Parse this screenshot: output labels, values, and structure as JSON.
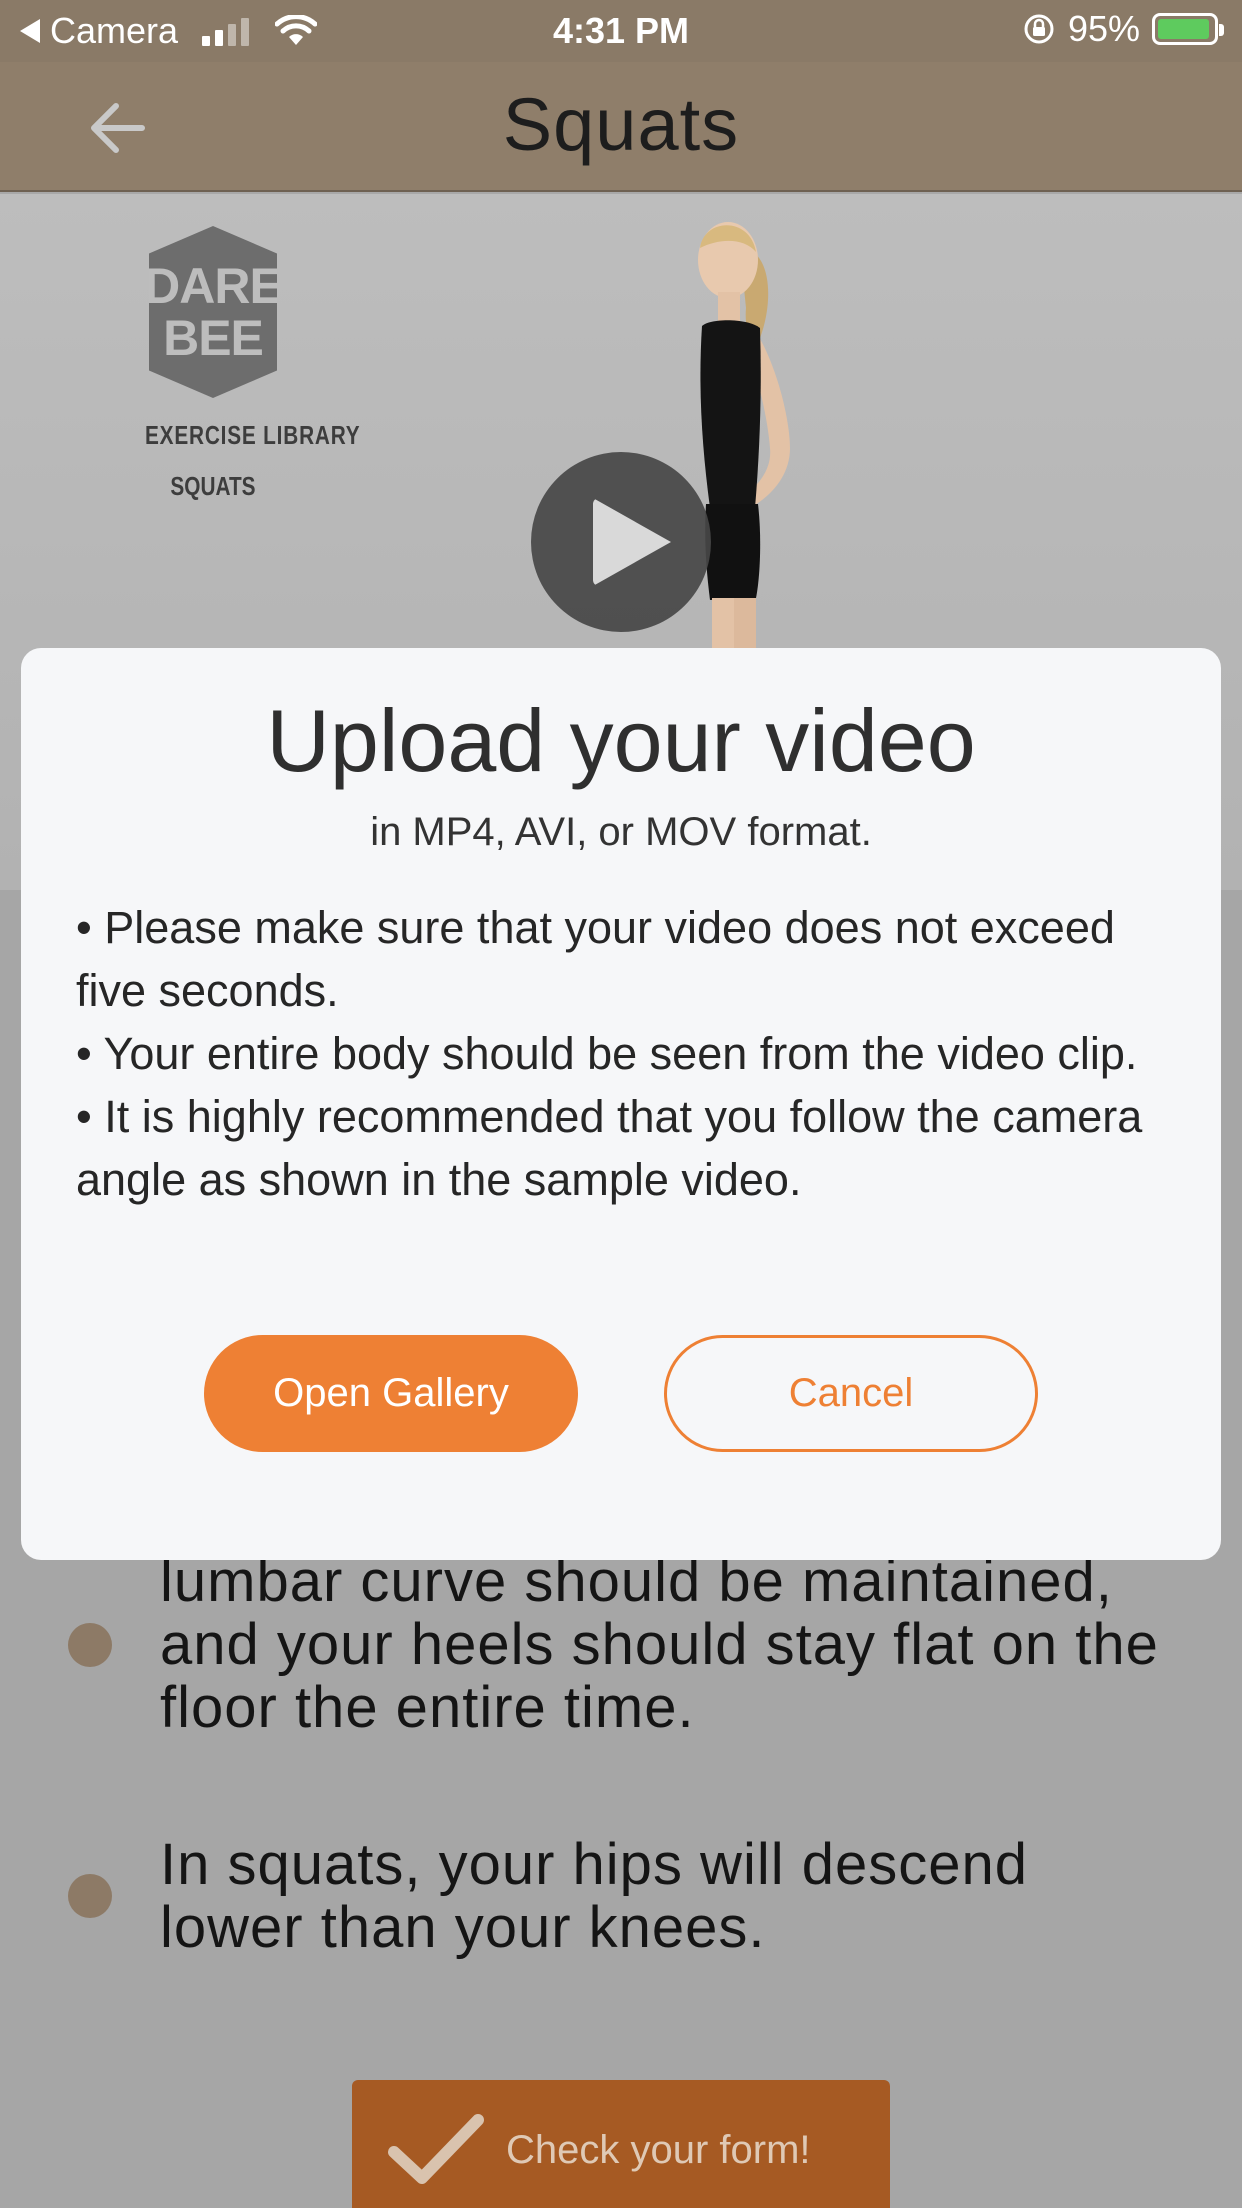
{
  "status_bar": {
    "back_app": "Camera",
    "time": "4:31 PM",
    "battery": "95%"
  },
  "nav": {
    "title": "Squats"
  },
  "video": {
    "logo_line1": "DARE",
    "logo_line2": "BEE",
    "library_label": "EXERCISE LIBRARY",
    "exercise_label": "SQUATS"
  },
  "dialog": {
    "title": "Upload your video",
    "subtitle": "in MP4, AVI, or MOV format.",
    "bullet_1": "• Please make sure that your video does not exceed five seconds.",
    "bullet_2": "• Your entire body should be seen from the video clip.",
    "bullet_3": "• It is highly recommended that you follow the camera angle as shown in the sample video.",
    "primary_label": "Open Gallery",
    "secondary_label": "Cancel"
  },
  "tips": [
    {
      "text": "lumbar curve should be maintained, and your heels should stay flat on the floor the entire time."
    },
    {
      "text": "In squats, your hips will descend lower than your knees."
    }
  ],
  "check_button": {
    "label": "Check your form!"
  },
  "colors": {
    "accent": "#ee8034",
    "header": "#8f7e6a",
    "bullet_dot": "#8d7a66"
  }
}
